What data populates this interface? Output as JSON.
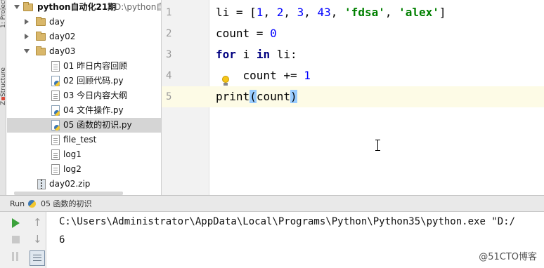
{
  "sidebar": {
    "strip_labels": [
      "1: Project",
      "Z: Structure"
    ]
  },
  "project_tree": {
    "items": [
      {
        "label": "python自动化21期",
        "hint": "D:\\python自",
        "type": "folder",
        "expanded": true
      },
      {
        "label": "day",
        "type": "folder",
        "expanded": false
      },
      {
        "label": "day02",
        "type": "folder",
        "expanded": false
      },
      {
        "label": "day03",
        "type": "folder",
        "expanded": true
      },
      {
        "label": "01 昨日内容回顾",
        "type": "text"
      },
      {
        "label": "02 回顾代码.py",
        "type": "py"
      },
      {
        "label": "03 今日内容大纲",
        "type": "text"
      },
      {
        "label": "04 文件操作.py",
        "type": "py"
      },
      {
        "label": "05 函数的初识.py",
        "type": "py",
        "selected": true
      },
      {
        "label": "file_test",
        "type": "text"
      },
      {
        "label": "log1",
        "type": "text"
      },
      {
        "label": "log2",
        "type": "text"
      },
      {
        "label": "day02.zip",
        "type": "zip"
      }
    ]
  },
  "editor": {
    "line_numbers": [
      "1",
      "2",
      "3",
      "4",
      "5"
    ],
    "current_line": 5,
    "lines": {
      "l1": {
        "a": "li = [",
        "n1": "1",
        "c1": ", ",
        "n2": "2",
        "c2": ", ",
        "n3": "3",
        "c3": ", ",
        "n4": "43",
        "c4": ", ",
        "s1": "'fdsa'",
        "c5": ", ",
        "s2": "'alex'",
        "end": "]"
      },
      "l2": {
        "a": "count = ",
        "n1": "0"
      },
      "l3": {
        "kw1": "for",
        "a": " i ",
        "kw2": "in",
        "b": " li:"
      },
      "l4": {
        "a": "    count += ",
        "n1": "1"
      },
      "l5": {
        "a": "print",
        "lp": "(",
        "b": "count",
        "rp": ")"
      }
    }
  },
  "run_panel": {
    "title": "Run",
    "tab_label": "05 函数的初识",
    "output": [
      "C:\\Users\\Administrator\\AppData\\Local\\Programs\\Python\\Python35\\python.exe \"D:/",
      "6"
    ]
  },
  "watermark": "@51CTO博客"
}
